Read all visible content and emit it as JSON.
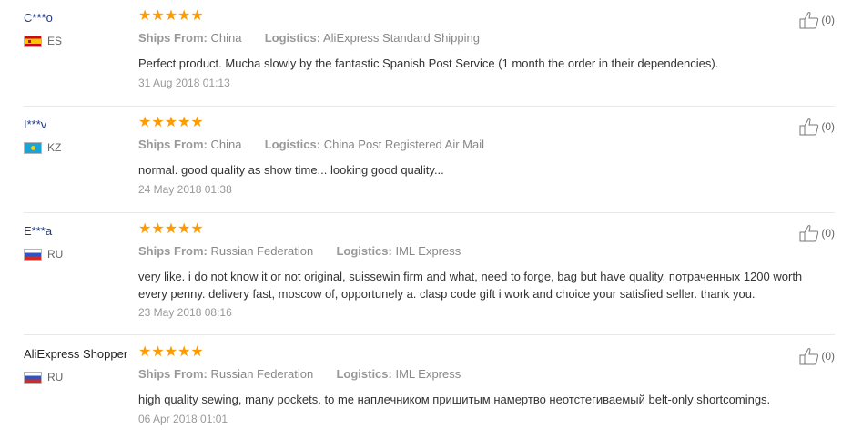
{
  "reviews": [
    {
      "user": "C***o",
      "country": "ES",
      "flag": "spain-flag-icon",
      "stars": 5,
      "ships_label": "Ships From:",
      "ships_from": "China",
      "logistics_label": "Logistics:",
      "logistics": "AliExpress Standard Shipping",
      "text": "Perfect product. Mucha slowly by the fantastic Spanish Post Service (1 month the order in their dependencies).",
      "date": "31 Aug 2018 01:13",
      "helpful": "(0)"
    },
    {
      "user": "I***v",
      "country": "KZ",
      "flag": "kazakhstan-flag-icon",
      "stars": 5,
      "ships_label": "Ships From:",
      "ships_from": "China",
      "logistics_label": "Logistics:",
      "logistics": "China Post Registered Air Mail",
      "text": "normal. good quality as show time... looking good quality...",
      "date": "24 May 2018 01:38",
      "helpful": "(0)"
    },
    {
      "user": "E***a",
      "country": "RU",
      "flag": "russia-flag-icon",
      "stars": 5,
      "ships_label": "Ships From:",
      "ships_from": "Russian Federation",
      "logistics_label": "Logistics:",
      "logistics": "IML Express",
      "text": "very like. i do not know it or not original, suissewin firm and what, need to forge, bag but have quality. потраченных 1200 worth every penny. delivery fast, moscow of, opportunely a. clasp code gift i work and choice your satisfied seller. thank you.",
      "date": "23 May 2018 08:16",
      "helpful": "(0)"
    },
    {
      "user": "AliExpress Shopper",
      "country": "RU",
      "flag": "russia-flag-icon",
      "stars": 5,
      "ships_label": "Ships From:",
      "ships_from": "Russian Federation",
      "logistics_label": "Logistics:",
      "logistics": "IML Express",
      "text": "high quality sewing, many pockets. to me наплечником пришитым намертво неотстегиваемый belt-only shortcomings.",
      "date": "06 Apr 2018 01:01",
      "helpful": "(0)"
    }
  ],
  "colors": {
    "star": "#ff9a00",
    "username": "#1e3a8a",
    "divider": "#e8e8e8"
  },
  "icons": {
    "star": "star-icon",
    "helpful": "thumbs-up-icon"
  }
}
